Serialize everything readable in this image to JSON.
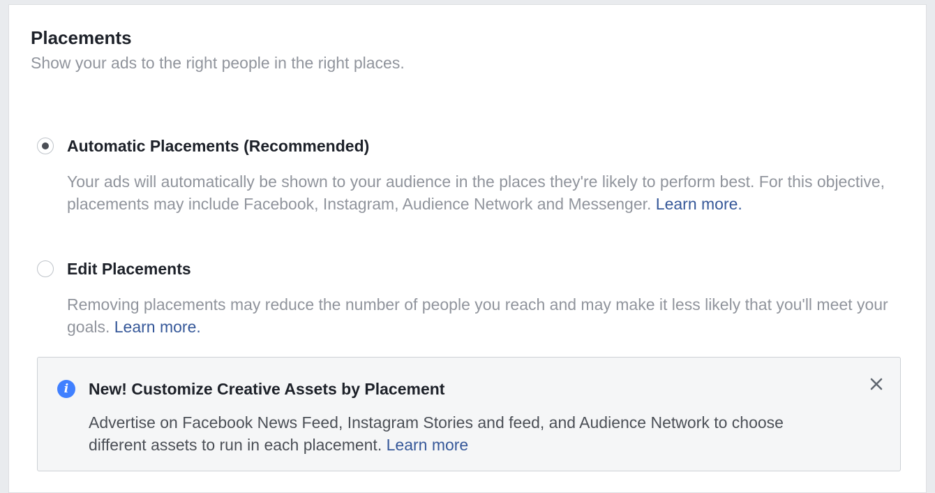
{
  "header": {
    "title": "Placements",
    "subtitle": "Show your ads to the right people in the right places."
  },
  "options": [
    {
      "label": "Automatic Placements (Recommended)",
      "selected": true,
      "description": "Your ads will automatically be shown to your audience in the places they're likely to perform best. For this objective, placements may include Facebook, Instagram, Audience Network and Messenger. ",
      "link": "Learn more."
    },
    {
      "label": "Edit Placements",
      "selected": false,
      "description": "Removing placements may reduce the number of people you reach and may make it less likely that you'll meet your goals. ",
      "link": "Learn more."
    }
  ],
  "notice": {
    "icon": "info-icon",
    "title": "New! Customize Creative Assets by Placement",
    "body": "Advertise on Facebook News Feed, Instagram Stories and feed, and Audience Network to choose different assets to run in each placement. ",
    "link": "Learn more",
    "close_icon": "close-icon"
  },
  "colors": {
    "link": "#365899",
    "info": "#4080ff",
    "muted_text": "#90949c",
    "text": "#1d2129"
  }
}
